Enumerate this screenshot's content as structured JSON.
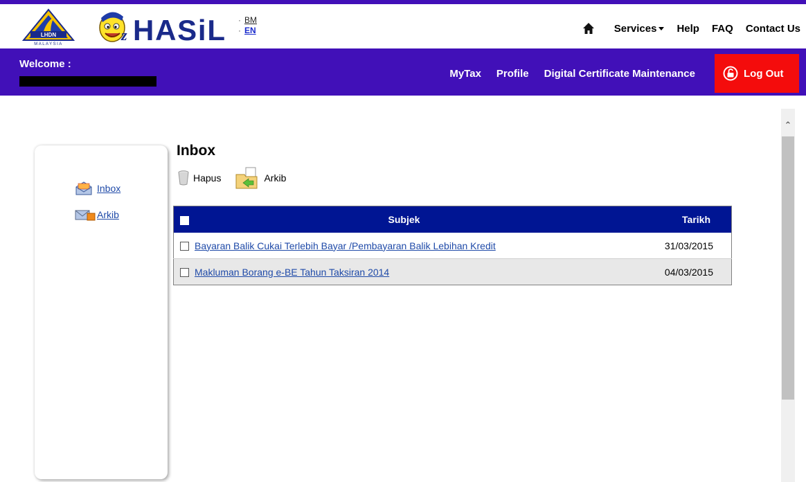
{
  "logos": {
    "lhdn_text": "LHDN",
    "lhdn_subtext": "MALAYSIA",
    "ezhasil_text": "HASiL"
  },
  "language": {
    "bm": "BM",
    "en": "EN"
  },
  "top_nav": {
    "services": "Services",
    "help": "Help",
    "faq": "FAQ",
    "contact": "Contact Us"
  },
  "welcome": {
    "label": "Welcome :"
  },
  "main_nav": {
    "mytax": "MyTax",
    "profile": "Profile",
    "digital_cert": "Digital Certificate Maintenance",
    "logout": "Log Out"
  },
  "sidebar": {
    "items": [
      {
        "label": "Inbox",
        "icon": "open-envelope-icon"
      },
      {
        "label": "Arkib",
        "icon": "archive-mail-icon"
      }
    ]
  },
  "page": {
    "title": "Inbox"
  },
  "toolbar": {
    "delete_label": "Hapus",
    "archive_label": "Arkib"
  },
  "table": {
    "columns": {
      "subject": "Subjek",
      "date": "Tarikh"
    },
    "rows": [
      {
        "subject": "Bayaran Balik Cukai Terlebih Bayar /Pembayaran Balik Lebihan Kredit",
        "date": "31/03/2015"
      },
      {
        "subject": "Makluman Borang e-BE Tahun Taksiran 2014",
        "date": "04/03/2015"
      }
    ]
  },
  "colors": {
    "brand_purple": "#4110b8",
    "logout_red": "#f40c0c",
    "table_header": "#001593",
    "link": "#1f4aa8"
  }
}
